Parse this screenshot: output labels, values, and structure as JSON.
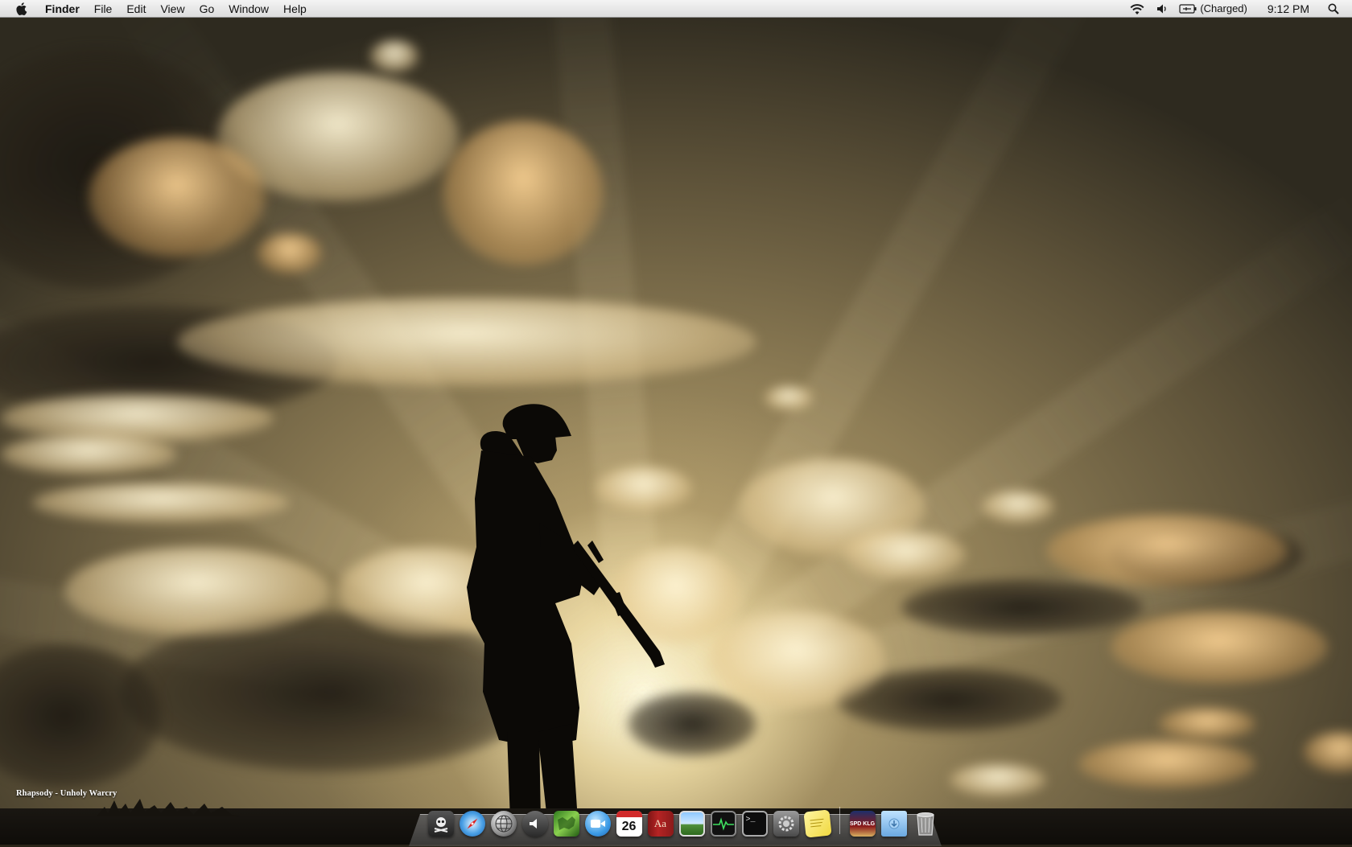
{
  "menubar": {
    "app_name": "Finder",
    "menus": [
      "File",
      "Edit",
      "View",
      "Go",
      "Window",
      "Help"
    ],
    "battery_status": "(Charged)",
    "clock": "9:12 PM"
  },
  "desktop": {
    "now_playing": "Rhapsody - Unholy Warcry"
  },
  "dock": {
    "apps": [
      {
        "icon": "pirate-skull-icon"
      },
      {
        "icon": "safari-compass-icon"
      },
      {
        "icon": "globe-icon"
      },
      {
        "icon": "speaker-icon"
      },
      {
        "icon": "green-map-icon"
      },
      {
        "icon": "ichat-video-icon"
      },
      {
        "icon": "ical-calendar-icon",
        "label": "26"
      },
      {
        "icon": "dictionary-icon",
        "label": "Aa"
      },
      {
        "icon": "preview-landscape-icon"
      },
      {
        "icon": "activity-monitor-icon"
      },
      {
        "icon": "terminal-icon",
        "label": ">_"
      },
      {
        "icon": "system-preferences-icon"
      },
      {
        "icon": "stickies-icon"
      }
    ],
    "stacks": [
      {
        "icon": "dvd-cover-icon",
        "label": "SPD KLG"
      },
      {
        "icon": "downloads-folder-icon"
      },
      {
        "icon": "trash-icon"
      }
    ]
  },
  "colors": {
    "menubar_top": "#f4f4f4",
    "menubar_bottom": "#dcdcdc",
    "sky_glow": "#fff0c0",
    "silhouette": "#0b0906"
  }
}
